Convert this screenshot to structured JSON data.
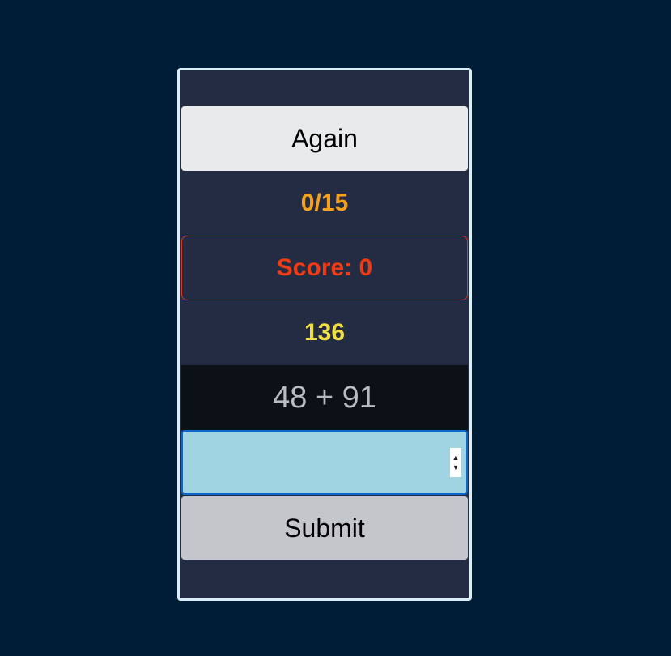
{
  "game": {
    "again_label": "Again",
    "progress": "0/15",
    "score_text": "Score: 0",
    "target": "136",
    "problem": "48 + 91",
    "answer": {
      "value": "",
      "placeholder": ""
    },
    "spinner": {
      "up": "▲",
      "down": "▼"
    },
    "submit_label": "Submit"
  },
  "colors": {
    "page_background": "#001d38",
    "panel_background": "#232c43",
    "panel_border": "#d9eef5",
    "progress": "#f7a11a",
    "score": "#f13a12",
    "target": "#f2e040",
    "problem_background": "#0b1117",
    "input_background": "#a1d4e2",
    "input_border": "#0b67c9"
  }
}
